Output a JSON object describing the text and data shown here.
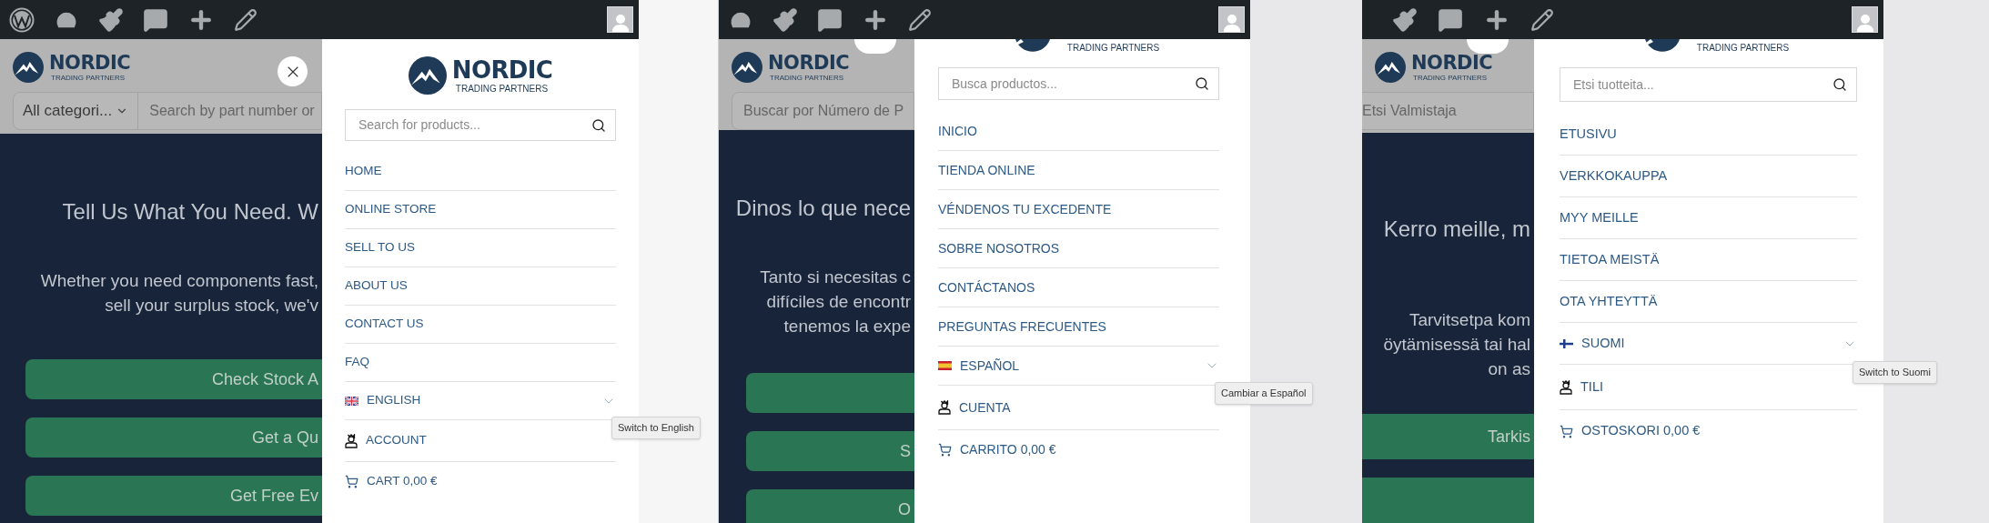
{
  "panels": [
    {
      "page": {
        "logo": {
          "name": "NORDIC",
          "tagline": "TRADING PARTNERS"
        },
        "category_select": {
          "value": "All categori..."
        },
        "search": {
          "placeholder": "Search by part number or"
        },
        "hero": {
          "heading": "Tell Us What You Need. W",
          "lines": [
            "Whether you need components fast,",
            "sell your surplus stock, we'v"
          ],
          "buttons": [
            {
              "kind": "labeled",
              "label": "Check Stock A"
            },
            {
              "kind": "labeled",
              "label": "Get a Qu"
            },
            {
              "kind": "labeled",
              "label": "Get Free Ev"
            }
          ]
        }
      },
      "drawer": {
        "logo": {
          "name": "NORDIC",
          "tagline": "TRADING PARTNERS"
        },
        "search": {
          "placeholder": "Search for products..."
        },
        "menu": [
          {
            "kind": "link",
            "label": "HOME"
          },
          {
            "kind": "link",
            "label": "ONLINE STORE"
          },
          {
            "kind": "link",
            "label": "SELL TO US"
          },
          {
            "kind": "link",
            "label": "ABOUT US"
          },
          {
            "kind": "link",
            "label": "CONTACT US"
          },
          {
            "kind": "link",
            "label": "FAQ"
          },
          {
            "kind": "language",
            "label": "ENGLISH",
            "expanded": false,
            "tooltip": "Switch to English"
          },
          {
            "kind": "account",
            "label": "ACCOUNT"
          },
          {
            "kind": "cart",
            "label": "CART 0,00 €"
          }
        ]
      }
    },
    {
      "page": {
        "logo": {
          "name": "NORDIC",
          "tagline": "TRADING PARTNERS"
        },
        "search": {
          "placeholder": "Buscar por Número de P"
        },
        "hero": {
          "heading": "Dinos lo que nece",
          "lines": [
            "Tanto si necesitas c",
            "difíciles de encontr",
            "tenemos la expe"
          ],
          "buttons": [
            {
              "kind": "blank"
            },
            {
              "kind": "labeled",
              "label": "S"
            },
            {
              "kind": "labeled",
              "label": "O"
            }
          ]
        }
      },
      "drawer": {
        "logo": {
          "tagline": "TRADING PARTNERS"
        },
        "search": {
          "placeholder": "Busca productos..."
        },
        "menu": [
          {
            "kind": "link",
            "label": "INICIO"
          },
          {
            "kind": "link",
            "label": "TIENDA ONLINE"
          },
          {
            "kind": "link",
            "label": "VÉNDENOS TU EXCEDENTE"
          },
          {
            "kind": "link",
            "label": "SOBRE NOSOTROS"
          },
          {
            "kind": "link",
            "label": "CONTÁCTANOS"
          },
          {
            "kind": "link",
            "label": "PREGUNTAS FRECUENTES"
          },
          {
            "kind": "language",
            "label": "ESPAÑOL",
            "expanded": false,
            "tooltip": "Cambiar a Español"
          },
          {
            "kind": "account",
            "label": "CUENTA"
          },
          {
            "kind": "cart",
            "label": "CARRITO 0,00 €"
          }
        ]
      }
    },
    {
      "page": {
        "logo": {
          "name": "NORDIC",
          "tagline": "TRADING PARTNERS"
        },
        "search": {
          "placeholder": "Etsi Valmistaja"
        },
        "hero": {
          "heading": "Kerro meille, m",
          "lines": [
            "Tarvitsetpa kom",
            "öytämisessä tai hal",
            "on as"
          ],
          "buttons": [
            {
              "kind": "labeled",
              "label": "Tarkis"
            },
            {
              "kind": "blank"
            }
          ]
        }
      },
      "drawer": {
        "logo": {
          "tagline": "TRADING PARTNERS"
        },
        "search": {
          "placeholder": "Etsi tuotteita..."
        },
        "menu": [
          {
            "kind": "link",
            "label": "ETUSIVU"
          },
          {
            "kind": "link",
            "label": "VERKKOKAUPPA"
          },
          {
            "kind": "link",
            "label": "MYY MEILLE"
          },
          {
            "kind": "link",
            "label": "TIETOA MEISTÄ"
          },
          {
            "kind": "link",
            "label": "OTA YHTEYTTÄ"
          },
          {
            "kind": "language",
            "label": "SUOMI",
            "expanded": false,
            "tooltip": "Switch to Suomi"
          },
          {
            "kind": "account",
            "label": "TILI"
          },
          {
            "kind": "cart",
            "label": "OSTOSKORI 0,00 €"
          }
        ]
      }
    }
  ]
}
